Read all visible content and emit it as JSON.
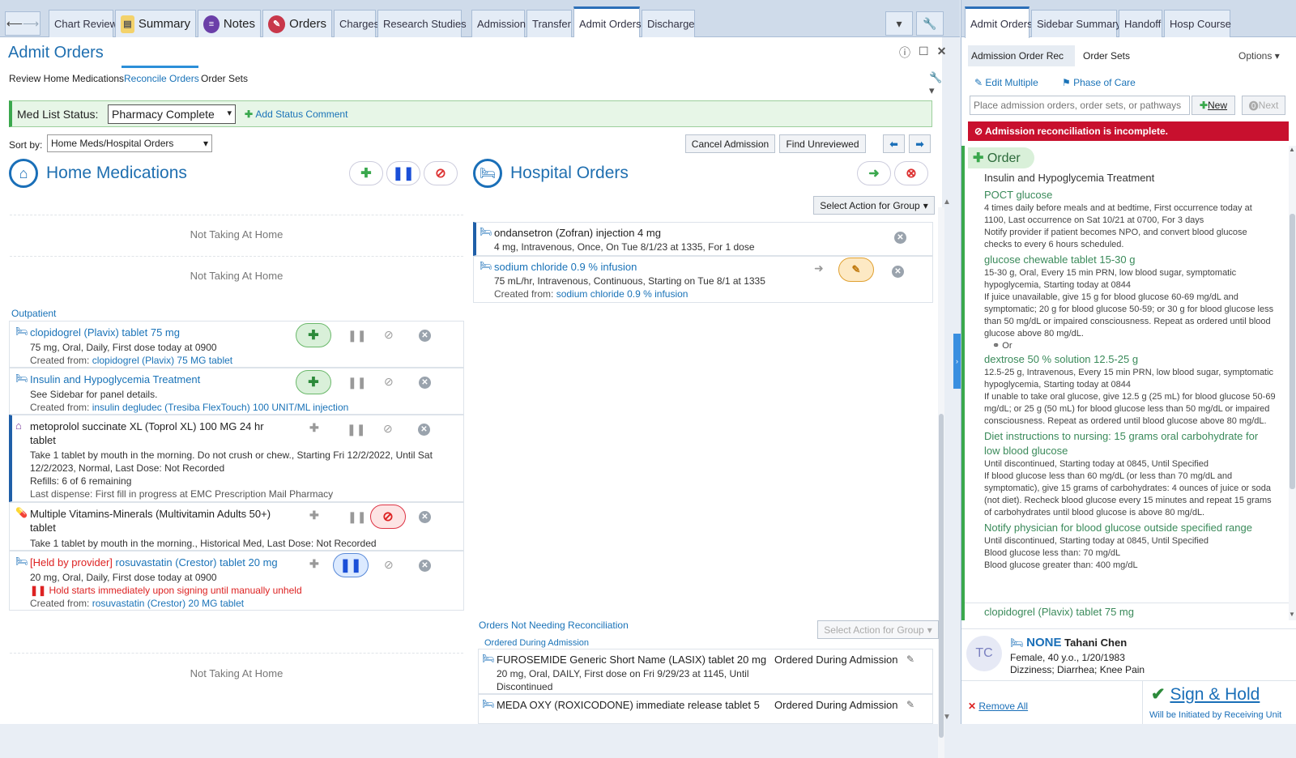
{
  "tabs": [
    "Chart Review",
    "Summary",
    "Notes",
    "Orders",
    "Charges",
    "Research Studies",
    "Admission",
    "Transfer",
    "Admit Orders",
    "Discharge"
  ],
  "right_tabs": [
    "Admit Orders",
    "Sidebar Summary",
    "Handoff",
    "Hosp Course"
  ],
  "title": "Admit Orders",
  "subtabs": [
    "Review Home Medications",
    "Reconcile Orders",
    "Order Sets"
  ],
  "med_status": {
    "label": "Med List Status:",
    "value": "Pharmacy Complete",
    "add_comment": "Add Status Comment"
  },
  "sort": {
    "label": "Sort by:",
    "value": "Home Meds/Hospital Orders"
  },
  "buttons": {
    "cancel": "Cancel Admission",
    "find": "Find Unreviewed",
    "select_action": "Select Action for Group"
  },
  "home": {
    "title": "Home Medications",
    "not_taking": "Not Taking At Home",
    "outpatient": "Outpatient",
    "meds": [
      {
        "name": "clopidogrel (Plavix) tablet 75 mg",
        "sig": "75 mg, Oral, Daily, First dose today at 0900",
        "created_label": "Created from:",
        "created": "clopidogrel (Plavix) 75 MG tablet"
      },
      {
        "name": "Insulin and Hypoglycemia Treatment",
        "sig": "See Sidebar for panel details.",
        "created_label": "Created from:",
        "created": "insulin degludec (Tresiba FlexTouch) 100 UNIT/ML injection"
      },
      {
        "name": "metoprolol succinate XL (Toprol XL) 100 MG 24 hr tablet",
        "sig": "Take 1 tablet by mouth in the morning. Do not crush or chew., Starting Fri 12/2/2022, Until Sat 12/2/2023, Normal, Last Dose: Not Recorded",
        "refills": "Refills: 6 of 6 remaining",
        "dispense": "Last dispense: First fill in progress at EMC Prescription Mail Pharmacy"
      },
      {
        "name": "Multiple Vitamins-Minerals (Multivitamin Adults 50+) tablet",
        "sig": "Take 1 tablet by mouth in the morning., Historical Med, Last Dose: Not Recorded"
      },
      {
        "held": "[Held by provider]",
        "name": "rosuvastatin (Crestor) tablet 20 mg",
        "sig": "20 mg, Oral, Daily, First dose today at 0900",
        "hold": "Hold starts immediately upon signing until manually unheld",
        "created_label": "Created from:",
        "created": "rosuvastatin (Crestor) 20 MG tablet"
      }
    ]
  },
  "hospital": {
    "title": "Hospital Orders",
    "orders": [
      {
        "name": "ondansetron (Zofran) injection 4 mg",
        "sig": "4 mg, Intravenous, Once, On Tue 8/1/23 at 1335, For 1 dose"
      },
      {
        "name": "sodium chloride 0.9 % infusion",
        "sig": "75 mL/hr, Intravenous, Continuous, Starting on Tue 8/1 at 1335",
        "created_label": "Created from:",
        "created": "sodium chloride 0.9 % infusion"
      }
    ],
    "not_needing": "Orders Not Needing Reconciliation",
    "ordered_during": "Ordered During Admission",
    "during": [
      {
        "name": "FUROSEMIDE Generic Short Name (LASIX) tablet 20 mg",
        "tag": "Ordered During Admission",
        "sig": "20 mg, Oral, DAILY, First dose on Fri 9/29/23 at 1145, Until Discontinued"
      },
      {
        "name": "MEDA OXY (ROXICODONE) immediate release tablet 5",
        "tag": "Ordered During Admission"
      }
    ]
  },
  "right": {
    "subtabs": [
      "Admission Order Rec",
      "Order Sets"
    ],
    "options": "Options",
    "edit_multiple": "Edit Multiple",
    "phase": "Phase of Care",
    "search_placeholder": "Place admission orders, order sets, or pathways",
    "new": "New",
    "next": "Next",
    "alert": "Admission reconciliation is incomplete.",
    "order_header": "Order",
    "group": "Insulin and Hypoglycemia Treatment",
    "items": [
      {
        "name": "POCT glucose",
        "lines": [
          "4 times daily before meals and at bedtime, First occurrence today at 1100, Last occurrence on Sat 10/21 at 0700, For 3 days",
          "Notify provider if patient becomes NPO, and convert blood glucose checks to every 6 hours scheduled."
        ]
      },
      {
        "name": "glucose chewable tablet 15-30 g",
        "lines": [
          "15-30 g, Oral, Every 15 min PRN, low blood sugar, symptomatic hypoglycemia, Starting today at 0844",
          "If juice unavailable, give 15 g for blood glucose 60-69 mg/dL and symptomatic; 20 g for blood glucose 50-59; or 30 g for blood glucose less than 50 mg/dL or impaired consciousness. Repeat as ordered until blood glucose above 80 mg/dL."
        ]
      },
      {
        "name": "dextrose 50 % solution 12.5-25 g",
        "lines": [
          "12.5-25 g, Intravenous, Every 15 min PRN, low blood sugar, symptomatic hypoglycemia, Starting today at 0844",
          "If unable to take oral glucose, give 12.5 g (25 mL) for blood glucose 50-69 mg/dL; or 25 g (50 mL) for  blood glucose less than 50 mg/dL or impaired consciousness. Repeat as ordered until blood glucose above 80 mg/dL."
        ]
      },
      {
        "name": "Diet instructions to nursing: 15 grams oral carbohydrate for low blood glucose",
        "lines": [
          "Until discontinued, Starting today at 0845, Until Specified",
          "If blood glucose less than 60 mg/dL (or less than 70 mg/dL and symptomatic), give 15 grams of carbohydrates: 4 ounces of juice or soda (not diet). Recheck blood glucose every 15 minutes and repeat 15 grams of carbohydrates until blood glucose is above 80 mg/dL."
        ]
      },
      {
        "name": "Notify physician for blood glucose outside specified range",
        "lines": [
          "Until discontinued, Starting today at 0845, Until Specified",
          "Blood glucose less than: 70 mg/dL",
          "Blood glucose greater than: 400 mg/dL"
        ]
      },
      {
        "name": "clopidogrel (Plavix) tablet 75 mg",
        "lines": []
      }
    ],
    "or_label": "Or",
    "patient": {
      "initials": "TC",
      "none": "NONE",
      "name": "Tahani Chen",
      "demo": "Female, 40 y.o., 1/20/1983",
      "problems": "Dizziness; Diarrhea; Knee Pain"
    },
    "remove_all": "Remove All",
    "sign": "Sign & Hold",
    "sign_sub": "Will be Initiated by Receiving Unit"
  }
}
